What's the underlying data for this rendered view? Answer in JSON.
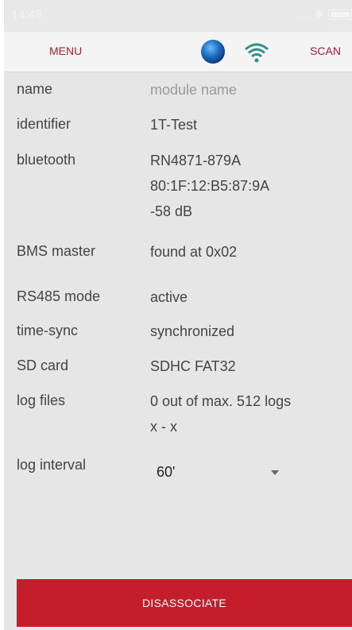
{
  "status_bar": {
    "time": "14:48",
    "indicators": "..."
  },
  "toolbar": {
    "menu_label": "MENU",
    "scan_label": "SCAN",
    "connection_icon": "blue-dot-icon",
    "signal_icon": "wifi-icon"
  },
  "fields": {
    "name": {
      "label": "name",
      "placeholder": "module name"
    },
    "identifier": {
      "label": "identifier",
      "value": "1T-Test"
    },
    "bluetooth": {
      "label": "bluetooth",
      "lines": [
        "RN4871-879A",
        "80:1F:12:B5:87:9A",
        "-58 dB"
      ]
    },
    "bms_master": {
      "label": "BMS master",
      "value": "found at 0x02"
    },
    "rs485_mode": {
      "label": "RS485 mode",
      "value": "active"
    },
    "time_sync": {
      "label": "time-sync",
      "value": "synchronized"
    },
    "sd_card": {
      "label": "SD card",
      "value": "SDHC FAT32"
    },
    "log_files": {
      "label": "log files",
      "lines": [
        "0 out of max. 512 logs",
        "x - x"
      ]
    },
    "log_interval": {
      "label": "log interval",
      "selected": "60'"
    }
  },
  "actions": {
    "disassociate_label": "DISASSOCIATE"
  },
  "colors": {
    "accent": "#a01e2e",
    "button": "#c41d2b",
    "connection_dot": "#1e6fc2"
  }
}
